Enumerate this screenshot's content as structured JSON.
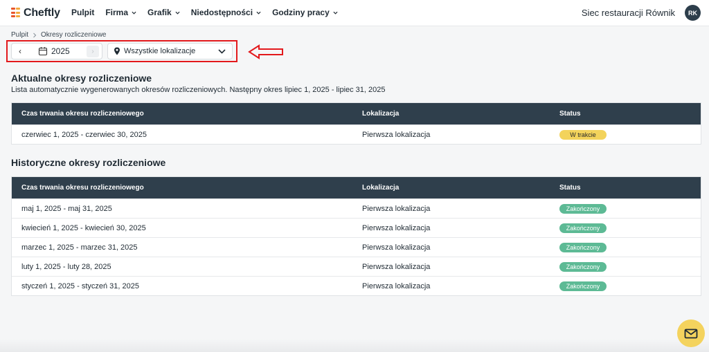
{
  "brand": {
    "name": "Cheftly",
    "mark_colors": [
      "#e8562a",
      "#f4a93b",
      "#e8562a",
      "#f4a93b",
      "#e8562a",
      "#f4a93b"
    ]
  },
  "nav": {
    "items": [
      {
        "label": "Pulpit",
        "has_menu": false
      },
      {
        "label": "Firma",
        "has_menu": true
      },
      {
        "label": "Grafik",
        "has_menu": true
      },
      {
        "label": "Niedostępności",
        "has_menu": true
      },
      {
        "label": "Godziny pracy",
        "has_menu": true
      }
    ],
    "company": "Siec restauracji Równik",
    "avatar": "RK"
  },
  "breadcrumb": {
    "home": "Pulpit",
    "current": "Okresy rozliczeniowe"
  },
  "filters": {
    "year": "2025",
    "location": "Wszystkie lokalizacje"
  },
  "current": {
    "title": "Aktualne okresy rozliczeniowe",
    "subtitle": "Lista automatycznie wygenerowanych okresów rozliczeniowych. Następny okres lipiec 1, 2025 - lipiec 31, 2025",
    "columns": [
      "Czas trwania okresu rozliczeniowego",
      "Lokalizacja",
      "Status"
    ],
    "rows": [
      {
        "period": "czerwiec 1, 2025 - czerwiec 30, 2025",
        "location": "Pierwsza lokalizacja",
        "status": "W trakcie"
      }
    ]
  },
  "history": {
    "title": "Historyczne okresy rozliczeniowe",
    "columns": [
      "Czas trwania okresu rozliczeniowego",
      "Lokalizacja",
      "Status"
    ],
    "rows": [
      {
        "period": "maj 1, 2025 - maj 31, 2025",
        "location": "Pierwsza lokalizacja",
        "status": "Zakończony"
      },
      {
        "period": "kwiecień 1, 2025 - kwiecień 30, 2025",
        "location": "Pierwsza lokalizacja",
        "status": "Zakończony"
      },
      {
        "period": "marzec 1, 2025 - marzec 31, 2025",
        "location": "Pierwsza lokalizacja",
        "status": "Zakończony"
      },
      {
        "period": "luty 1, 2025 - luty 28, 2025",
        "location": "Pierwsza lokalizacja",
        "status": "Zakończony"
      },
      {
        "period": "styczeń 1, 2025 - styczeń 31, 2025",
        "location": "Pierwsza lokalizacja",
        "status": "Zakończony"
      }
    ]
  },
  "colors": {
    "header": "#2f3f4c",
    "in_progress": "#f3d35b",
    "done": "#5dba95",
    "annotation": "#e3191c",
    "fab": "#f4d35e"
  }
}
